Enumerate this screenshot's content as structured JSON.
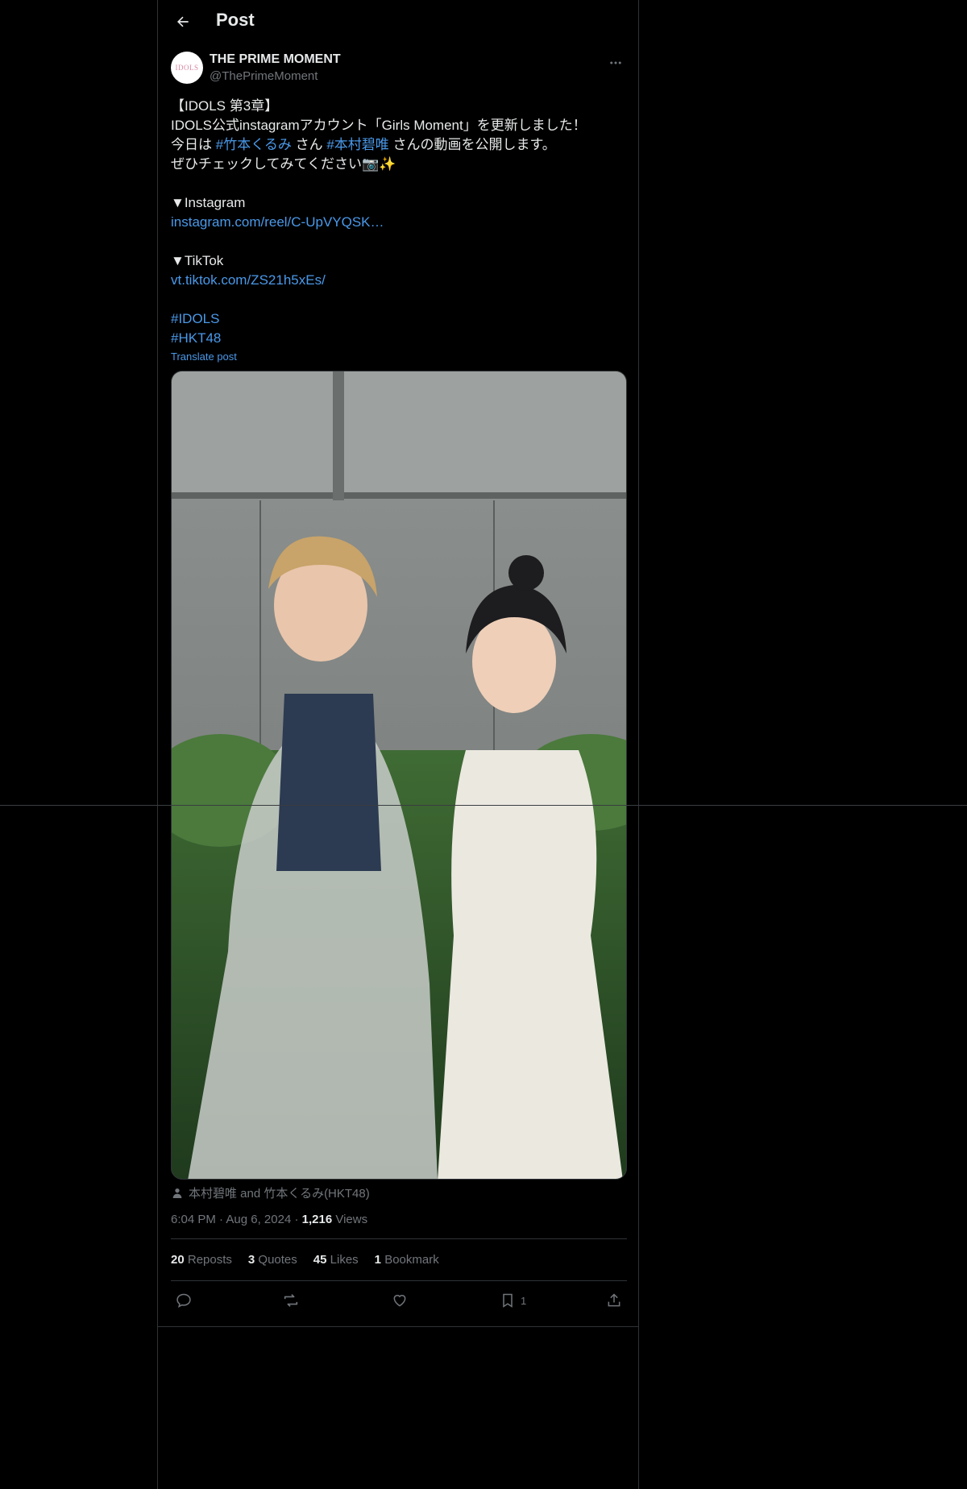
{
  "header": {
    "title": "Post"
  },
  "post": {
    "author": {
      "name": "THE PRIME MOMENT",
      "handle": "@ThePrimeMoment",
      "avatar_text": "IDOLS"
    },
    "lines": {
      "l1": "【IDOLS 第3章】",
      "l2": "IDOLS公式instagramアカウント「Girls Moment」を更新しました！",
      "l3_pre": "今日は ",
      "l3_tag1": "#竹本くるみ",
      "l3_mid": " さん ",
      "l3_tag2": "#本村碧唯",
      "l3_post": " さんの動画を公開します。",
      "l4": "ぜひチェックしてみてください📷✨",
      "instagram_label": "▼Instagram",
      "instagram_link": "instagram.com/reel/C-UpVYQSK…",
      "tiktok_label": "▼TikTok",
      "tiktok_link": "vt.tiktok.com/ZS21h5xEs/",
      "tag_idols": "#IDOLS",
      "tag_hkt": "#HKT48"
    },
    "translate": "Translate post",
    "tagged_people": "本村碧唯 and 竹本くるみ(HKT48)",
    "time": "6:04 PM",
    "date": "Aug 6, 2024",
    "views_count": "1,216",
    "views_label": "Views",
    "stats": {
      "reposts_count": "20",
      "reposts_label": "Reposts",
      "quotes_count": "3",
      "quotes_label": "Quotes",
      "likes_count": "45",
      "likes_label": "Likes",
      "bookmarks_count": "1",
      "bookmarks_label": "Bookmark"
    },
    "actions": {
      "bookmark_count": "1"
    }
  },
  "colors": {
    "background": "#000000",
    "text": "#e7e9ea",
    "muted": "#71767b",
    "link": "#4a99e9",
    "border": "#2f3336"
  }
}
